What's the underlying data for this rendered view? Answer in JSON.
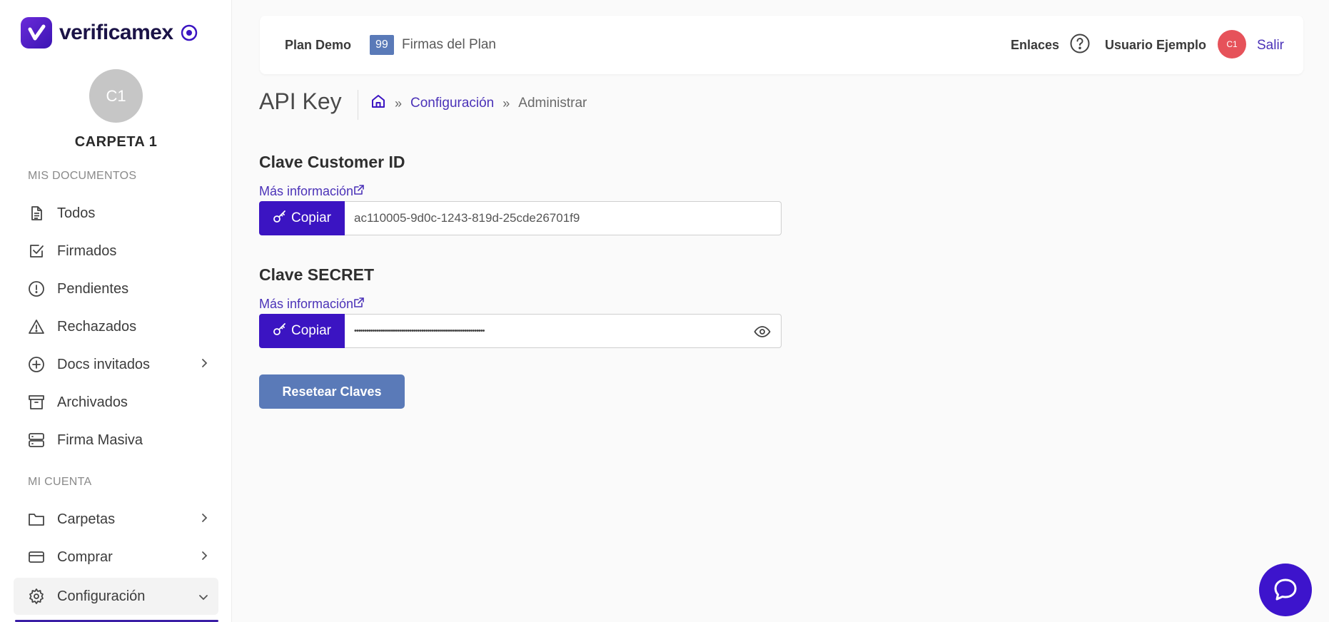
{
  "brand": {
    "name": "verificamex"
  },
  "profile": {
    "initials": "C1",
    "folder": "CARPETA 1"
  },
  "sidebar": {
    "section_docs": "MIS DOCUMENTOS",
    "docs_items": [
      {
        "label": "Todos",
        "icon": "document-icon"
      },
      {
        "label": "Firmados",
        "icon": "checkbox-icon"
      },
      {
        "label": "Pendientes",
        "icon": "alert-circle-icon"
      },
      {
        "label": "Rechazados",
        "icon": "warning-triangle-icon"
      },
      {
        "label": "Docs invitados",
        "icon": "plus-circle-icon"
      },
      {
        "label": "Archivados",
        "icon": "archive-icon"
      },
      {
        "label": "Firma Masiva",
        "icon": "server-icon"
      }
    ],
    "section_account": "MI CUENTA",
    "account_items": [
      {
        "label": "Carpetas",
        "icon": "folder-icon"
      },
      {
        "label": "Comprar",
        "icon": "credit-card-icon"
      },
      {
        "label": "Configuración",
        "icon": "gear-icon"
      }
    ]
  },
  "header": {
    "plan_name": "Plan Demo",
    "plan_count": "99",
    "plan_label": "Firmas del Plan",
    "links": "Enlaces",
    "user_name": "Usuario Ejemplo",
    "user_initials": "C1",
    "logout": "Salir"
  },
  "page": {
    "title": "API Key",
    "breadcrumb": {
      "parent": "Configuración",
      "current": "Administrar"
    }
  },
  "customer_key": {
    "title": "Clave Customer ID",
    "more_info": "Más información",
    "copy": "Copiar",
    "value": "ac110005-9d0c-1243-819d-25cde26701f9"
  },
  "secret_key": {
    "title": "Clave SECRET",
    "more_info": "Más información",
    "copy": "Copiar",
    "value": "••••••••••••••••••••••••••••••••••••••••••••••••••••••••••••••••"
  },
  "actions": {
    "reset": "Resetear Claves"
  },
  "colors": {
    "accent": "#3b14c2",
    "link": "#4b32b8",
    "secondary": "#5a7ab8",
    "avatar": "#e6525a"
  }
}
